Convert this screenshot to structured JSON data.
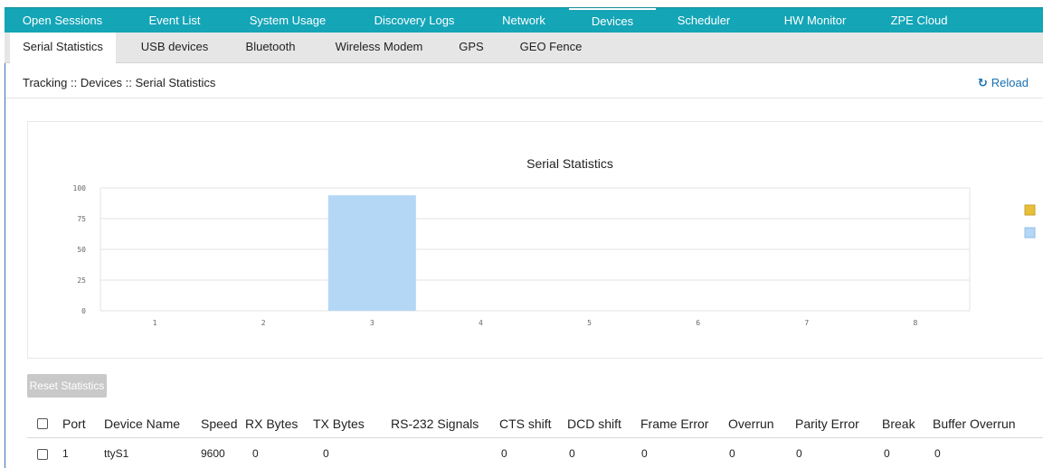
{
  "top_nav": {
    "tabs": [
      "Open Sessions",
      "Event List",
      "System Usage",
      "Discovery Logs",
      "Network",
      "Devices",
      "Scheduler",
      "HW Monitor",
      "ZPE Cloud"
    ],
    "active": "Devices"
  },
  "sub_nav": {
    "tabs": [
      "Serial Statistics",
      "USB devices",
      "Bluetooth",
      "Wireless Modem",
      "GPS",
      "GEO Fence"
    ],
    "active": "Serial Statistics"
  },
  "breadcrumb": "Tracking :: Devices :: Serial Statistics",
  "reload_label": "Reload",
  "reload_icon": "refresh-icon",
  "chart_data": {
    "type": "bar",
    "title": "Serial Statistics",
    "categories": [
      "1",
      "2",
      "3",
      "4",
      "5",
      "6",
      "7",
      "8"
    ],
    "series": [
      {
        "values": [
          0,
          0,
          0,
          0,
          0,
          0,
          0,
          0
        ],
        "color": "#e8bf3a"
      },
      {
        "values": [
          0,
          0,
          94,
          0,
          0,
          0,
          0,
          0
        ],
        "color": "#b3d7f5"
      }
    ],
    "yticks": [
      "0",
      "25",
      "50",
      "75",
      "100"
    ],
    "ylim": [
      0,
      100
    ],
    "grid": true,
    "legend_position": "right (clipped)"
  },
  "reset_button_label": "Reset Statistics",
  "table": {
    "columns": [
      "Port",
      "Device Name",
      "Speed",
      "RX Bytes",
      "TX Bytes",
      "RS-232 Signals",
      "CTS shift",
      "DCD shift",
      "Frame Error",
      "Overrun",
      "Parity Error",
      "Break",
      "Buffer Overrun"
    ],
    "rows": [
      {
        "port": "1",
        "device_name": "ttyS1",
        "speed": "9600",
        "rx_bytes": "0",
        "tx_bytes": "0",
        "rs232_signals": "",
        "cts_shift": "0",
        "dcd_shift": "0",
        "frame_error": "0",
        "overrun": "0",
        "parity_error": "0",
        "break": "0",
        "buffer_overrun": "0"
      }
    ]
  },
  "colors": {
    "nav_bg": "#14a5b7",
    "subnav_bg": "#e6e6e6",
    "link": "#1a6fb0",
    "button_disabled": "#c9c9c9"
  }
}
